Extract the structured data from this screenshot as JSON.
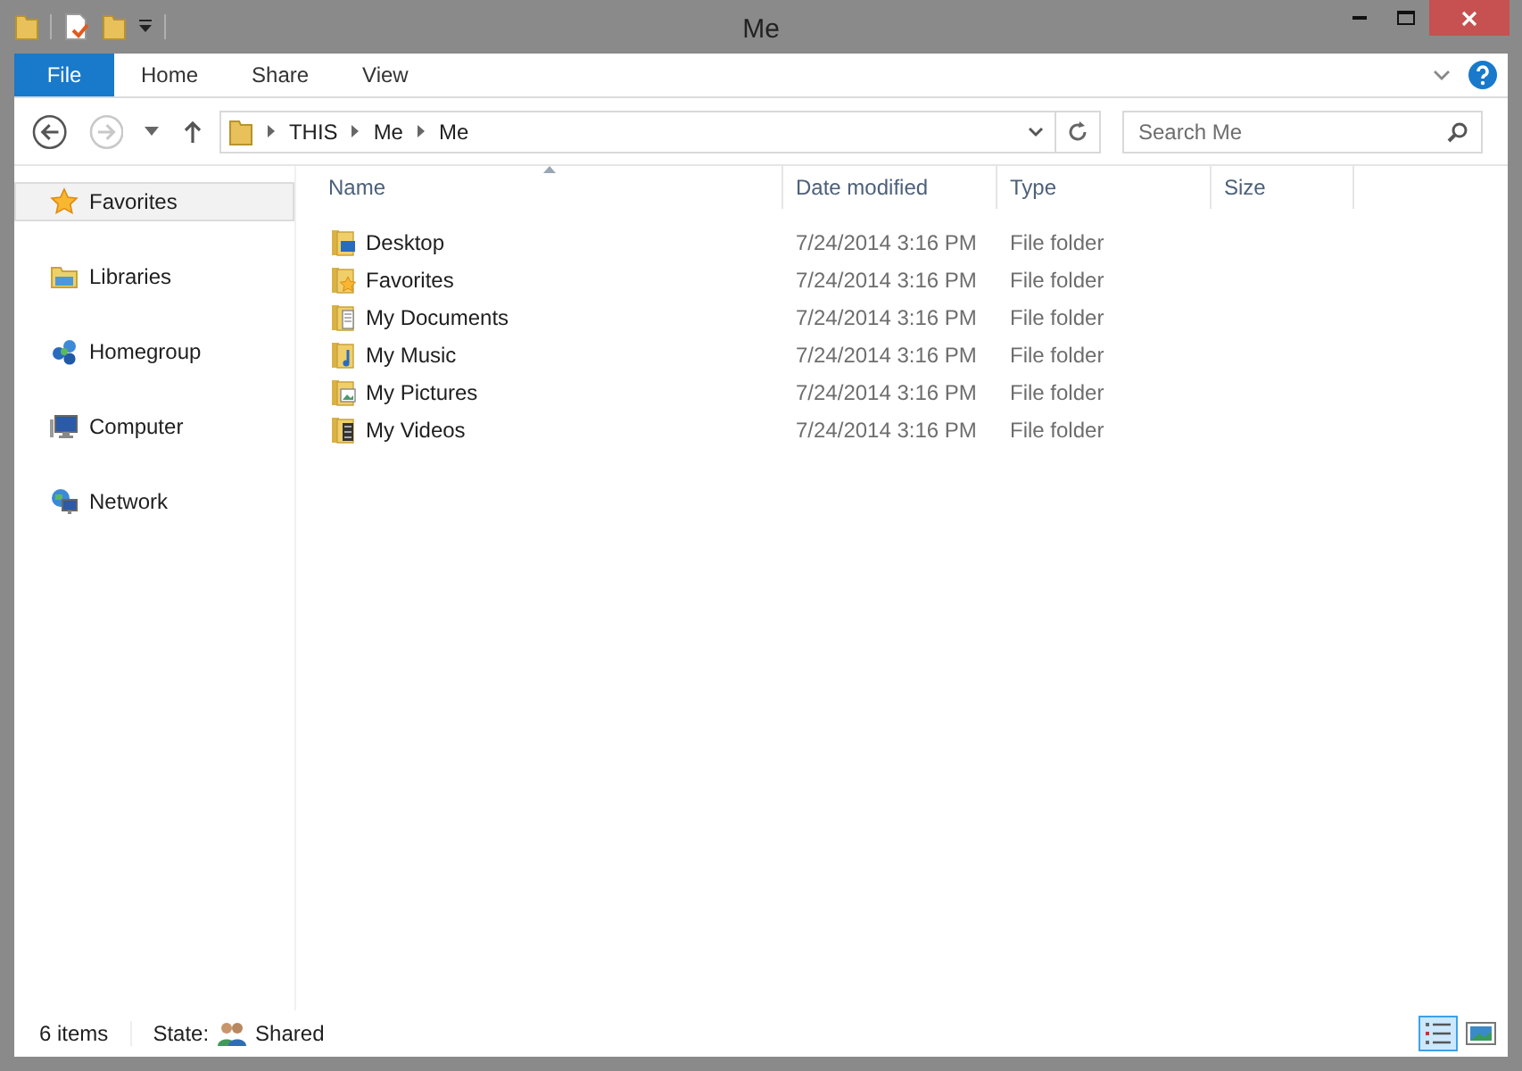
{
  "window": {
    "title": "Me"
  },
  "ribbon": {
    "tabs": [
      {
        "label": "File",
        "kind": "file"
      },
      {
        "label": "Home",
        "kind": "tab"
      },
      {
        "label": "Share",
        "kind": "tab"
      },
      {
        "label": "View",
        "kind": "tab"
      }
    ]
  },
  "navigation": {
    "back_enabled": true,
    "forward_enabled": false
  },
  "address": {
    "path": [
      "THIS",
      "Me",
      "Me"
    ]
  },
  "search": {
    "placeholder": "Search Me"
  },
  "sidebar": {
    "items": [
      {
        "label": "Favorites",
        "kind": "star",
        "selected": true
      },
      {
        "label": "Libraries",
        "kind": "libraries",
        "selected": false
      },
      {
        "label": "Homegroup",
        "kind": "homegroup",
        "selected": false
      },
      {
        "label": "Computer",
        "kind": "computer",
        "selected": false
      },
      {
        "label": "Network",
        "kind": "network",
        "selected": false
      }
    ]
  },
  "table": {
    "columns": [
      {
        "label": "Name",
        "sorted": true
      },
      {
        "label": "Date modified",
        "sorted": false
      },
      {
        "label": "Type",
        "sorted": false
      },
      {
        "label": "Size",
        "sorted": false
      }
    ],
    "rows": [
      {
        "name": "Desktop",
        "date_modified": "7/24/2014 3:16 PM",
        "type": "File folder",
        "kind": "desktop"
      },
      {
        "name": "Favorites",
        "date_modified": "7/24/2014 3:16 PM",
        "type": "File folder",
        "kind": "favorites"
      },
      {
        "name": "My Documents",
        "date_modified": "7/24/2014 3:16 PM",
        "type": "File folder",
        "kind": "documents"
      },
      {
        "name": "My Music",
        "date_modified": "7/24/2014 3:16 PM",
        "type": "File folder",
        "kind": "music"
      },
      {
        "name": "My Pictures",
        "date_modified": "7/24/2014 3:16 PM",
        "type": "File folder",
        "kind": "pictures"
      },
      {
        "name": "My Videos",
        "date_modified": "7/24/2014 3:16 PM",
        "type": "File folder",
        "kind": "videos"
      }
    ]
  },
  "status_bar": {
    "item_count": "6 items",
    "state_label": "State:",
    "state_value": "Shared"
  },
  "views": [
    {
      "kind": "details",
      "selected": true
    },
    {
      "kind": "large-icons",
      "selected": false
    }
  ]
}
